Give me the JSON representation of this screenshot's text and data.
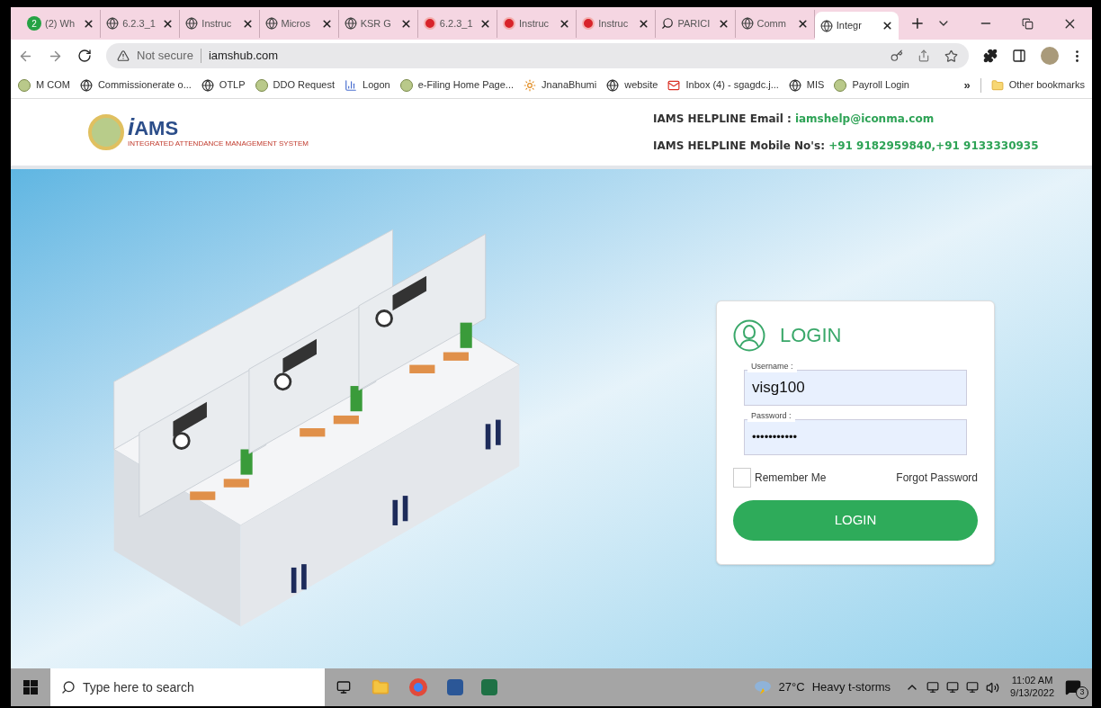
{
  "browser": {
    "tabs": [
      {
        "label": "(2) Wh",
        "kind": "badge",
        "badge": "2",
        "selected": false
      },
      {
        "label": "6.2.3_1",
        "kind": "globe",
        "selected": false
      },
      {
        "label": "Instruc",
        "kind": "globe",
        "selected": false
      },
      {
        "label": "Micros",
        "kind": "globe",
        "selected": false
      },
      {
        "label": "KSR G",
        "kind": "globe",
        "selected": false
      },
      {
        "label": "6.2.3_1",
        "kind": "red",
        "selected": false
      },
      {
        "label": "Instruc",
        "kind": "red",
        "selected": false
      },
      {
        "label": "Instruc",
        "kind": "red",
        "selected": false
      },
      {
        "label": "PARICI",
        "kind": "search",
        "selected": false
      },
      {
        "label": "Comm",
        "kind": "globe",
        "selected": false
      },
      {
        "label": "Integr",
        "kind": "globe",
        "selected": true
      }
    ],
    "security": "Not secure",
    "url": "iamshub.com",
    "bookmarks": [
      {
        "label": "M COM",
        "kind": "emblem"
      },
      {
        "label": "Commissionerate o...",
        "kind": "globe"
      },
      {
        "label": "OTLP",
        "kind": "globe"
      },
      {
        "label": "DDO Request",
        "kind": "emblem"
      },
      {
        "label": "Logon",
        "kind": "chart"
      },
      {
        "label": "e-Filing Home Page...",
        "kind": "emblem"
      },
      {
        "label": "JnanaBhumi",
        "kind": "sun"
      },
      {
        "label": "website",
        "kind": "globe"
      },
      {
        "label": "Inbox (4) - sgagdc.j...",
        "kind": "mail"
      },
      {
        "label": "MIS",
        "kind": "globe"
      },
      {
        "label": "Payroll Login",
        "kind": "emblem"
      }
    ],
    "more": "»",
    "other_bookmarks": "Other bookmarks"
  },
  "header": {
    "logo_text": "AMS",
    "logo_i": "i",
    "logo_subtitle": "INTEGRATED ATTENDANCE MANAGEMENT SYSTEM",
    "email_label": "IAMS HELPLINE Email : ",
    "email": "iamshelp@iconma.com",
    "mobile_label": "IAMS HELPLINE Mobile No's: ",
    "mobile": "+91 9182959840,+91 9133330935"
  },
  "login": {
    "title": "LOGIN",
    "username_label": "Username :",
    "username": "visg100",
    "password_label": "Password :",
    "password": "•••••••••••",
    "remember": {
      "label": "Remember Me",
      "checked": false
    },
    "forgot": "Forgot Password",
    "button": "LOGIN"
  },
  "taskbar": {
    "search_placeholder": "Type here to search",
    "temperature": "27°C",
    "weather": "Heavy t-storms",
    "time": "11:02 AM",
    "date": "9/13/2022",
    "notifications": "3"
  }
}
